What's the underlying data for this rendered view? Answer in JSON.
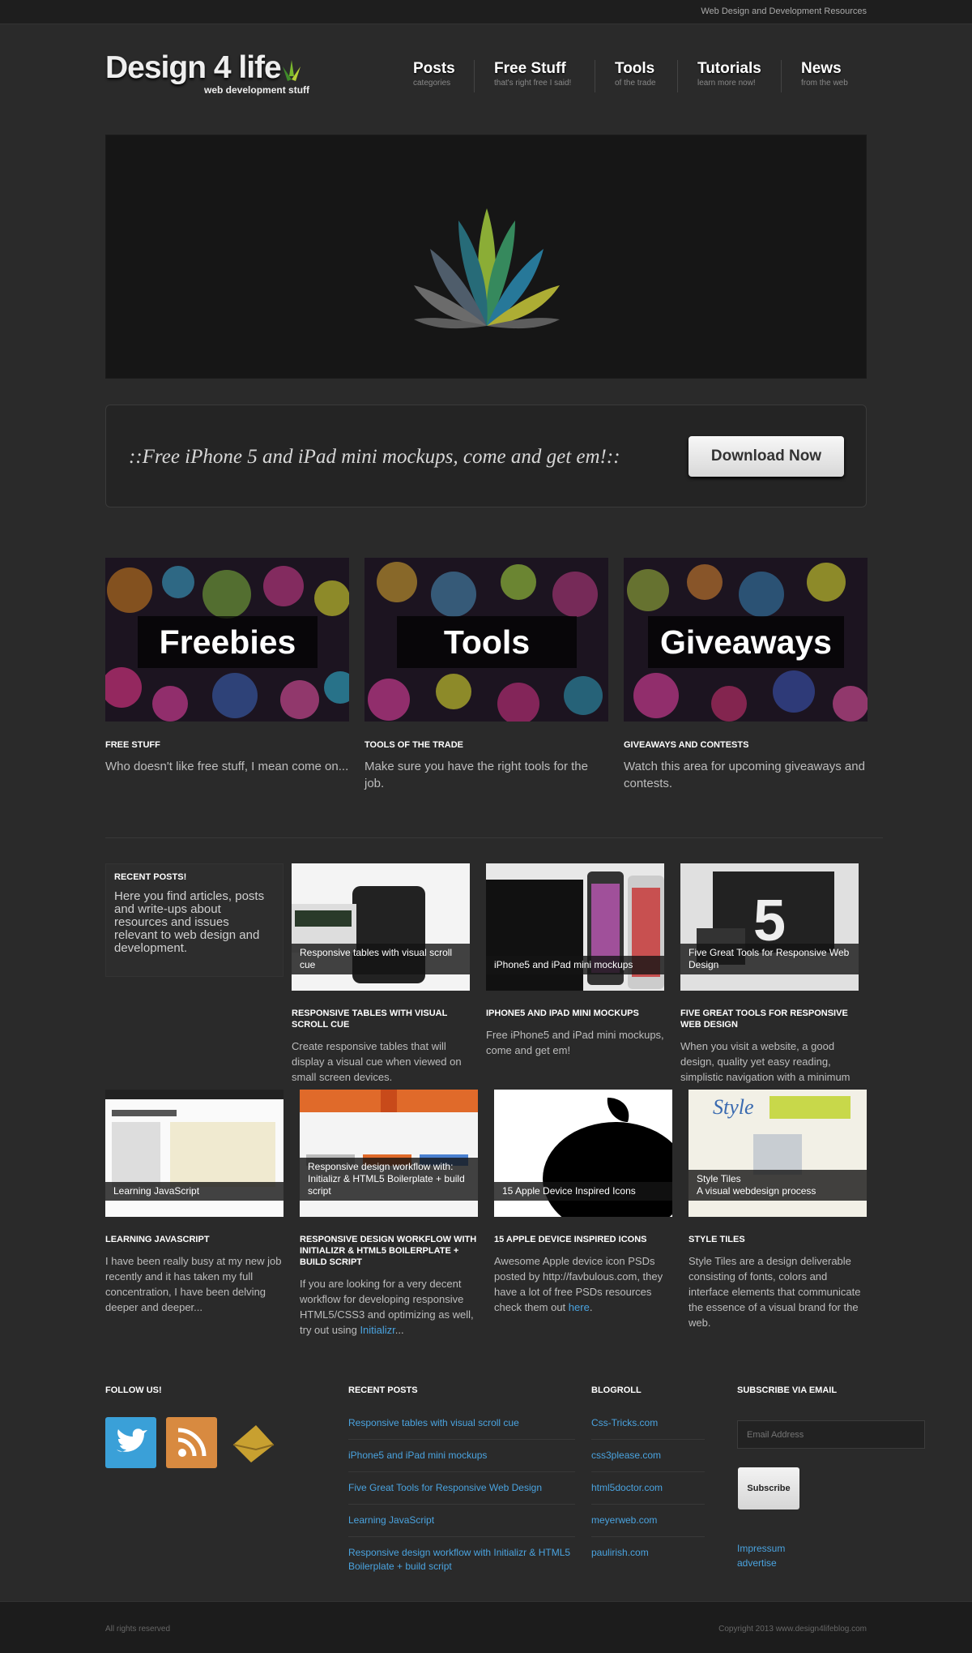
{
  "topbar": {
    "tagline": "Web Design and Development Resources"
  },
  "logo": {
    "title": "Design 4 life",
    "subtitle": "web development stuff"
  },
  "nav": [
    {
      "label": "Posts",
      "sub": "categories"
    },
    {
      "label": "Free Stuff",
      "sub": "that's right free I said!"
    },
    {
      "label": "Tools",
      "sub": "of the trade"
    },
    {
      "label": "Tutorials",
      "sub": "learn more now!"
    },
    {
      "label": "News",
      "sub": "from the web"
    }
  ],
  "cta": {
    "message": "::Free iPhone 5 and iPad mini mockups, come and get em!::",
    "button": "Download Now"
  },
  "features": [
    {
      "image_label": "Freebies",
      "title": "Free Stuff",
      "text": "Who doesn't like free stuff, I mean come on..."
    },
    {
      "image_label": "Tools",
      "title": "Tools of the trade",
      "text": "Make sure you have the right tools for the job."
    },
    {
      "image_label": "Giveaways",
      "title": "Giveaways and contests",
      "text": "Watch this area for upcoming giveaways and contests."
    }
  ],
  "recent_box": {
    "title": "RECENT POSTS!",
    "text": "Here you find articles, posts and write-ups about resources and issues relevant to web design and development."
  },
  "posts": [
    {
      "caption": "Responsive tables with visual scroll cue",
      "title": "Responsive tables with visual scroll cue",
      "text": "Create responsive tables that will display a visual cue when viewed on small screen devices."
    },
    {
      "caption": "iPhone5 and iPad mini mockups",
      "title": "iPhone5 and iPad mini mockups",
      "text": "Free iPhone5 and iPad mini mockups, come and get em!"
    },
    {
      "caption": "Five Great Tools for Responsive Web Design",
      "title": "Five Great Tools for Responsive Web Design",
      "text": "When you visit a website, a good design, quality yet easy reading, simplistic navigation with a minimum"
    },
    {
      "caption": "Learning JavaScript",
      "title": "Learning JavaScript",
      "text": "I have been really busy at my new job recently and it has taken my full concentration, I have been delving deeper and deeper..."
    },
    {
      "caption": "Responsive design workflow with: Initializr & HTML5 Boilerplate + build script",
      "title": "Responsive design workflow with Initializr & HTML5 Boilerplate + build script",
      "text": "If you are looking for a very decent workflow for developing responsive HTML5/CSS3 and optimizing as well, try out using ",
      "link": "Initializr",
      "after": "..."
    },
    {
      "caption": "15 Apple Device Inspired Icons",
      "title": "15 Apple Device Inspired Icons",
      "text": "Awesome Apple device icon PSDs posted by http://favbulous.com, they have a lot of free PSDs resources check them out ",
      "link": "here",
      "after": "."
    },
    {
      "caption": "Style Tiles\nA visual webdesign process",
      "title": "Style Tiles",
      "text": "Style Tiles are a design deliverable consisting of fonts, colors and interface elements that communicate the essence of a visual brand for the web."
    }
  ],
  "footer": {
    "follow": {
      "title": "FOLLOW US!"
    },
    "recent": {
      "title": "RECENT POSTS",
      "links": [
        "Responsive tables with visual scroll cue",
        "iPhone5 and iPad mini mockups",
        "Five Great Tools for Responsive Web Design",
        "Learning JavaScript",
        "Responsive design workflow with Initializr & HTML5 Boilerplate + build script"
      ]
    },
    "blogroll": {
      "title": "BLOGROLL",
      "links": [
        "Css-Tricks.com",
        "css3please.com",
        "html5doctor.com",
        "meyerweb.com",
        "paulirish.com"
      ]
    },
    "subscribe": {
      "title": "SUBSCRIBE VIA EMAIL",
      "placeholder": "Email Address",
      "button": "Subscribe",
      "links": [
        "Impressum",
        "advertise"
      ]
    }
  },
  "bottom": {
    "left": "All rights reserved",
    "right": "Copyright 2013 www.design4lifeblog.com"
  },
  "colors": {
    "background": "#2a2a2a",
    "link": "#4aa3df",
    "text": "#bdbdbd"
  }
}
